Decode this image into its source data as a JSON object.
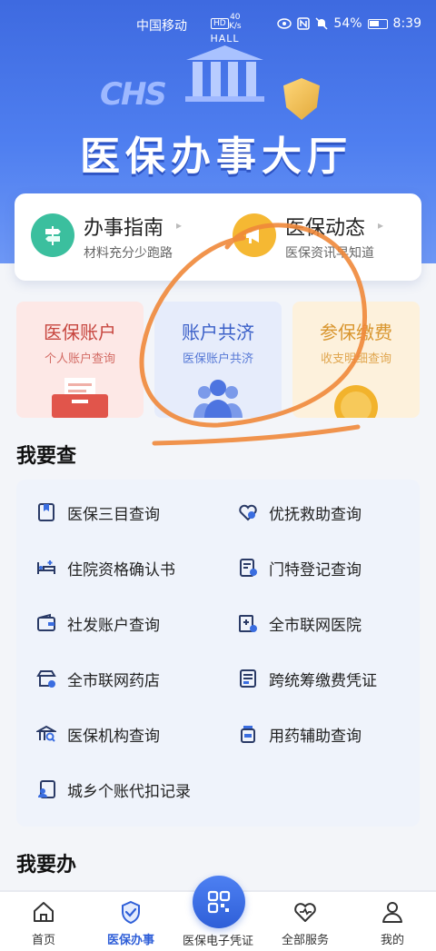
{
  "status_bar": {
    "carrier": "中国移动",
    "hd": "HD",
    "net_speed_value": "40",
    "net_speed_unit": "K/s",
    "battery": "54%",
    "time": "8:39"
  },
  "hero": {
    "building_label": "HALL",
    "logo_text": "CHS",
    "title": "医保办事大厅"
  },
  "guides": [
    {
      "title": "办事指南",
      "subtitle": "材料充分少跑路",
      "color": "#3bbf9e"
    },
    {
      "title": "医保动态",
      "subtitle": "医保资讯早知道",
      "color": "#f5b833"
    }
  ],
  "tiles": [
    {
      "title": "医保账户",
      "subtitle": "个人账户查询",
      "bg": "#fde8e6",
      "color": "#c7463f"
    },
    {
      "title": "账户共济",
      "subtitle": "医保账户共济",
      "bg": "#e6ecfb",
      "color": "#3a5fc8"
    },
    {
      "title": "参保缴费",
      "subtitle": "收支明细查询",
      "bg": "#fdf1dc",
      "color": "#d9962f"
    }
  ],
  "query_section": {
    "title": "我要查",
    "items": [
      {
        "label": "医保三目查询",
        "icon": "bookmark-book-icon"
      },
      {
        "label": "优抚救助查询",
        "icon": "heart-hand-icon"
      },
      {
        "label": "住院资格确认书",
        "icon": "hospital-bed-icon"
      },
      {
        "label": "门特登记查询",
        "icon": "register-form-icon"
      },
      {
        "label": "社发账户查询",
        "icon": "wallet-icon"
      },
      {
        "label": "全市联网医院",
        "icon": "network-hospital-icon"
      },
      {
        "label": "全市联网药店",
        "icon": "pharmacy-icon"
      },
      {
        "label": "跨统筹缴费凭证",
        "icon": "receipt-icon"
      },
      {
        "label": "医保机构查询",
        "icon": "institution-search-icon"
      },
      {
        "label": "用药辅助查询",
        "icon": "medicine-bottle-icon"
      },
      {
        "label": "城乡个账代扣记录",
        "icon": "user-record-icon"
      }
    ]
  },
  "handle_section": {
    "title": "我要办"
  },
  "tabbar": {
    "items": [
      {
        "label": "首页",
        "icon": "home-icon"
      },
      {
        "label": "医保办事",
        "icon": "shield-check-icon"
      },
      {
        "label": "医保电子凭证",
        "icon": "qr-code-icon"
      },
      {
        "label": "全部服务",
        "icon": "heart-service-icon"
      },
      {
        "label": "我的",
        "icon": "profile-icon"
      }
    ],
    "active_index": 1,
    "accent": "#2f5fd8"
  },
  "annotation": {
    "color": "#f0883a"
  }
}
